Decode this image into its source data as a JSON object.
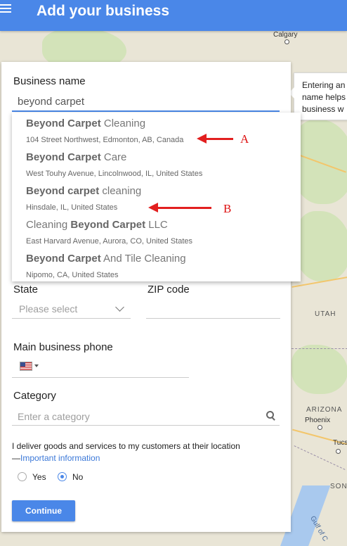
{
  "header": {
    "title": "Add your business"
  },
  "tooltip": {
    "lines": [
      "Entering an",
      "name helps",
      "business w"
    ]
  },
  "form": {
    "business_name_label": "Business name",
    "business_name_value": "beyond carpet",
    "state_label": "State",
    "state_placeholder": "Please select",
    "zip_label": "ZIP code",
    "phone_label": "Main business phone",
    "category_label": "Category",
    "category_placeholder": "Enter a category",
    "deliver_text": "I deliver goods and services to my customers at their location",
    "deliver_dash": "—",
    "important_link": "Important information",
    "yes_label": "Yes",
    "no_label": "No",
    "selected_option": "No",
    "continue_label": "Continue"
  },
  "suggestions": [
    {
      "bold": "Beyond Carpet",
      "rest": " Cleaning",
      "address": "104 Street Northwest, Edmonton, AB, Canada"
    },
    {
      "bold": "Beyond Carpet",
      "rest": " Care",
      "address": "West Touhy Avenue, Lincolnwood, IL, United States"
    },
    {
      "bold": "Beyond carpet",
      "rest": " cleaning",
      "address": "Hinsdale, IL, United States"
    },
    {
      "pre": "Cleaning ",
      "bold": "Beyond Carpet",
      "rest": " LLC",
      "address": "East Harvard Avenue, Aurora, CO, United States"
    },
    {
      "bold": "Beyond Carpet",
      "rest": " And Tile Cleaning",
      "address": "Nipomo, CA, United States"
    }
  ],
  "annotations": {
    "a": "A",
    "b": "B"
  },
  "map_labels": {
    "calgary": "Calgary",
    "utah": "UTAH",
    "arizona": "ARIZONA",
    "phoenix": "Phoenix",
    "tucson": "Tucso",
    "sonora": "SON",
    "gulf": "Gulf of C"
  },
  "colors": {
    "accent": "#4a87e8",
    "annotation": "#e21f1f"
  }
}
